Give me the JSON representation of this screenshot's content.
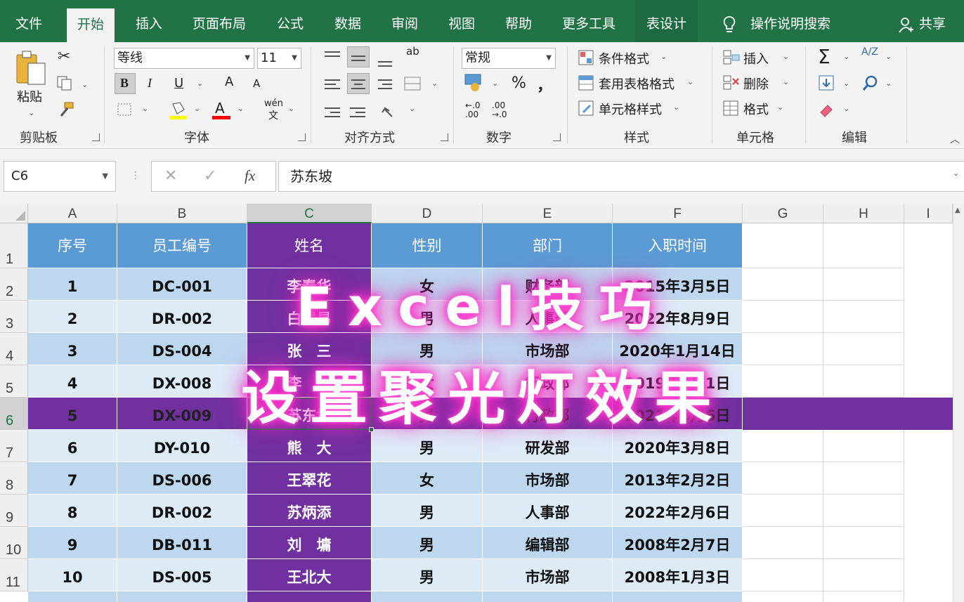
{
  "tabs": [
    "文件",
    "开始",
    "插入",
    "页面布局",
    "公式",
    "数据",
    "审阅",
    "视图",
    "帮助",
    "更多工具",
    "表设计"
  ],
  "tell_me": "操作说明搜索",
  "share": "共享",
  "ribbon": {
    "clipboard": {
      "paste": "粘贴",
      "label": "剪贴板"
    },
    "font": {
      "name": "等线",
      "size": "11",
      "bold": "B",
      "italic": "I",
      "underline": "U",
      "grow": "A",
      "shrink": "A",
      "color": "A",
      "phonetic": "wén",
      "phonetic_char": "文",
      "label": "字体"
    },
    "alignment": {
      "wrap": "ab",
      "label": "对齐方式"
    },
    "number": {
      "format": "常规",
      "percent": "%",
      "comma": "，",
      "inc_decimal": "←.0 .00",
      "dec_decimal": ".00 →.0",
      "label": "数字"
    },
    "styles": {
      "conditional": "条件格式",
      "table": "套用表格格式",
      "cell": "单元格样式",
      "label": "样式"
    },
    "cells": {
      "insert": "插入",
      "delete": "删除",
      "format": "格式",
      "label": "单元格"
    },
    "editing": {
      "sum": "Σ",
      "sort": "A/Z",
      "label": "编辑"
    }
  },
  "formula_bar": {
    "name_box": "C6",
    "cancel": "✕",
    "enter": "✓",
    "fx": "fx",
    "value": "苏东坡"
  },
  "columns": [
    "A",
    "B",
    "C",
    "D",
    "E",
    "F",
    "G",
    "H",
    "I"
  ],
  "rows": [
    "1",
    "2",
    "3",
    "4",
    "5",
    "6",
    "7",
    "8",
    "9",
    "10",
    "11"
  ],
  "table": {
    "headers": [
      "序号",
      "员工编号",
      "姓名",
      "性别",
      "部门",
      "入职时间"
    ],
    "data": [
      [
        "1",
        "DC-001",
        "李春华",
        "女",
        "财务部",
        "2015年3月5日"
      ],
      [
        "2",
        "DR-002",
        "白居易",
        "男",
        "人事部",
        "2022年8月9日"
      ],
      [
        "3",
        "DS-004",
        "张　三",
        "男",
        "市场部",
        "2020年1月14日"
      ],
      [
        "4",
        "DX-008",
        "李　四",
        "女",
        "行政部",
        "2019年6月1日"
      ],
      [
        "5",
        "DX-009",
        "苏东坡",
        "男",
        "行政部",
        "2021年8月6日"
      ],
      [
        "6",
        "DY-010",
        "熊　大",
        "男",
        "研发部",
        "2020年3月8日"
      ],
      [
        "7",
        "DS-006",
        "王翠花",
        "女",
        "市场部",
        "2013年2月2日"
      ],
      [
        "8",
        "DR-002",
        "苏炳添",
        "男",
        "人事部",
        "2022年2月6日"
      ],
      [
        "9",
        "DB-011",
        "刘　墉",
        "男",
        "编辑部",
        "2008年2月7日"
      ],
      [
        "10",
        "DS-005",
        "王北大",
        "男",
        "市场部",
        "2008年1月3日"
      ]
    ]
  },
  "overlay": {
    "line1": "Excel技巧",
    "line2": "设置聚光灯效果"
  },
  "colors": {
    "excel_green": "#217346",
    "header_blue": "#5b9bd5",
    "band_dark": "#bdd7ee",
    "band_light": "#ddebf7",
    "spotlight": "#7030a0",
    "glow": "#ff2fc8"
  }
}
